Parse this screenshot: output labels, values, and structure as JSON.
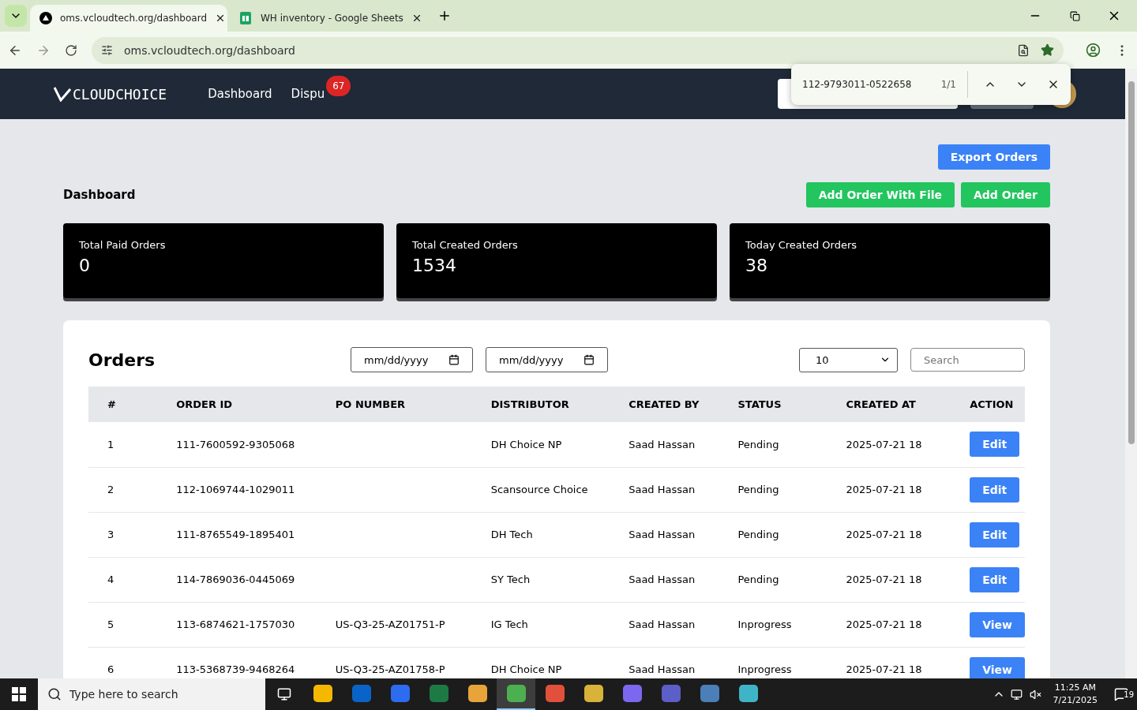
{
  "browser": {
    "tabs": [
      {
        "title": "oms.vcloudtech.org/dashboard",
        "selected": true
      },
      {
        "title": "WH inventory - Google Sheets",
        "selected": false
      }
    ],
    "url": "oms.vcloudtech.org/dashboard",
    "find_bar": {
      "query": "112-9793011-0522658",
      "count": "1/1"
    }
  },
  "navbar": {
    "logo": "CLOUDCHOICE",
    "links": [
      {
        "label": "Dashboard"
      },
      {
        "label": "Dispu",
        "badge": "67"
      }
    ]
  },
  "actions": {
    "export": "Export Orders",
    "add_with_file": "Add Order With File",
    "add": "Add Order"
  },
  "page_title": "Dashboard",
  "stats": [
    {
      "label": "Total Paid Orders",
      "value": "0"
    },
    {
      "label": "Total Created Orders",
      "value": "1534"
    },
    {
      "label": "Today Created Orders",
      "value": "38"
    }
  ],
  "orders": {
    "title": "Orders",
    "date_from": {
      "placeholder": "mm/dd/yyyy"
    },
    "date_to": {
      "placeholder": "mm/dd/yyyy"
    },
    "page_size": "10",
    "search": {
      "placeholder": "Search"
    },
    "columns": [
      "#",
      "ORDER ID",
      "PO NUMBER",
      "DISTRIBUTOR",
      "CREATED BY",
      "STATUS",
      "CREATED AT",
      "ACTION"
    ],
    "rows": [
      {
        "n": "1",
        "order_id": "111-7600592-9305068",
        "po": "",
        "distributor": "DH Choice NP",
        "created_by": "Saad Hassan",
        "status": "Pending",
        "created_at": "2025-07-21 18",
        "action": "Edit"
      },
      {
        "n": "2",
        "order_id": "112-1069744-1029011",
        "po": "",
        "distributor": "Scansource Choice",
        "created_by": "Saad Hassan",
        "status": "Pending",
        "created_at": "2025-07-21 18",
        "action": "Edit"
      },
      {
        "n": "3",
        "order_id": "111-8765549-1895401",
        "po": "",
        "distributor": "DH Tech",
        "created_by": "Saad Hassan",
        "status": "Pending",
        "created_at": "2025-07-21 18",
        "action": "Edit"
      },
      {
        "n": "4",
        "order_id": "114-7869036-0445069",
        "po": "",
        "distributor": "SY Tech",
        "created_by": "Saad Hassan",
        "status": "Pending",
        "created_at": "2025-07-21 18",
        "action": "Edit"
      },
      {
        "n": "5",
        "order_id": "113-6874621-1757030",
        "po": "US-Q3-25-AZ01751-P",
        "distributor": "IG Tech",
        "created_by": "Saad Hassan",
        "status": "Inprogress",
        "created_at": "2025-07-21 18",
        "action": "View"
      },
      {
        "n": "6",
        "order_id": "113-5368739-9468264",
        "po": "US-Q3-25-AZ01758-P",
        "distributor": "DH Choice NP",
        "created_by": "Saad Hassan",
        "status": "Inprogress",
        "created_at": "2025-07-21 18",
        "action": "View"
      }
    ]
  },
  "taskbar": {
    "search_placeholder": "Type here to search",
    "apps": [
      {
        "color": "#f5b800",
        "selected": false
      },
      {
        "color": "#0a64c8",
        "selected": false
      },
      {
        "color": "#2d6cf0",
        "selected": false
      },
      {
        "color": "#1e7a44",
        "selected": false
      },
      {
        "color": "#e8a33a",
        "selected": false
      },
      {
        "color": "#4caf50",
        "selected": true
      },
      {
        "color": "#e0503a",
        "selected": false
      },
      {
        "color": "#d9b23a",
        "selected": false
      },
      {
        "color": "#7b68ee",
        "selected": false
      },
      {
        "color": "#5b5fc7",
        "selected": false
      },
      {
        "color": "#4a7fb8",
        "selected": false
      },
      {
        "color": "#3fb4c6",
        "selected": false
      }
    ],
    "time": "11:25 AM",
    "date": "7/21/2025",
    "notifications": "19"
  }
}
